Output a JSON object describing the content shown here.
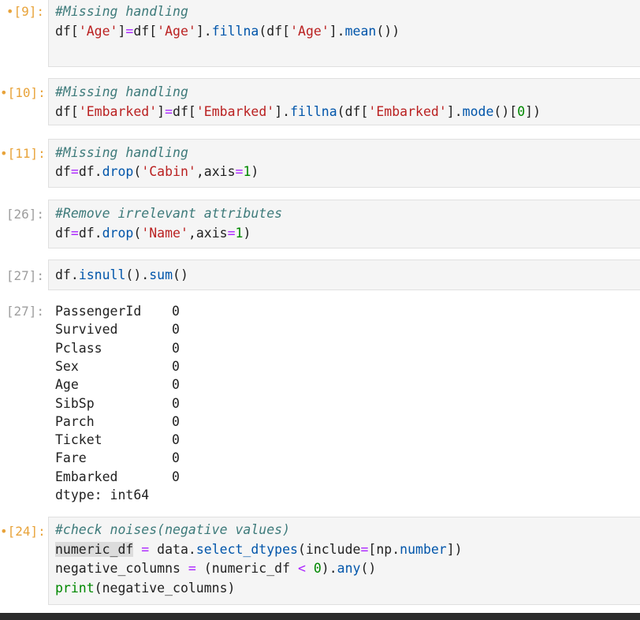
{
  "cells": [
    {
      "prompt": "[9]:",
      "dirty_marker": "•",
      "lines": [
        [
          {
            "t": "#Missing handling",
            "c": "cm"
          }
        ],
        [
          {
            "t": "df[",
            "c": ""
          },
          {
            "t": "'Age'",
            "c": "st"
          },
          {
            "t": "]",
            "c": ""
          },
          {
            "t": "=",
            "c": "op"
          },
          {
            "t": "df[",
            "c": ""
          },
          {
            "t": "'Age'",
            "c": "st"
          },
          {
            "t": "].",
            "c": ""
          },
          {
            "t": "fillna",
            "c": "fn"
          },
          {
            "t": "(df[",
            "c": ""
          },
          {
            "t": "'Age'",
            "c": "st"
          },
          {
            "t": "].",
            "c": ""
          },
          {
            "t": "mean",
            "c": "fn"
          },
          {
            "t": "())",
            "c": ""
          }
        ]
      ]
    },
    {
      "prompt": "[10]:",
      "dirty_marker": "•",
      "lines": [
        [
          {
            "t": "#Missing handling",
            "c": "cm"
          }
        ],
        [
          {
            "t": "df[",
            "c": ""
          },
          {
            "t": "'Embarked'",
            "c": "st"
          },
          {
            "t": "]",
            "c": ""
          },
          {
            "t": "=",
            "c": "op"
          },
          {
            "t": "df[",
            "c": ""
          },
          {
            "t": "'Embarked'",
            "c": "st"
          },
          {
            "t": "].",
            "c": ""
          },
          {
            "t": "fillna",
            "c": "fn"
          },
          {
            "t": "(df[",
            "c": ""
          },
          {
            "t": "'Embarked'",
            "c": "st"
          },
          {
            "t": "].",
            "c": ""
          },
          {
            "t": "mode",
            "c": "fn"
          },
          {
            "t": "()[",
            "c": ""
          },
          {
            "t": "0",
            "c": "nu"
          },
          {
            "t": "])",
            "c": ""
          }
        ]
      ]
    },
    {
      "prompt": "[11]:",
      "dirty_marker": "•",
      "lines": [
        [
          {
            "t": "#Missing handling",
            "c": "cm"
          }
        ],
        [
          {
            "t": "df",
            "c": ""
          },
          {
            "t": "=",
            "c": "op"
          },
          {
            "t": "df",
            "c": ""
          },
          {
            "t": ".",
            "c": ""
          },
          {
            "t": "drop",
            "c": "fn"
          },
          {
            "t": "(",
            "c": ""
          },
          {
            "t": "'Cabin'",
            "c": "st"
          },
          {
            "t": ",axis",
            "c": ""
          },
          {
            "t": "=",
            "c": "op"
          },
          {
            "t": "1",
            "c": "nu"
          },
          {
            "t": ")",
            "c": ""
          }
        ]
      ]
    },
    {
      "prompt": "[26]:",
      "dirty_marker": "",
      "lines": [
        [
          {
            "t": "#Remove irrelevant attributes",
            "c": "cm"
          }
        ],
        [
          {
            "t": "df",
            "c": ""
          },
          {
            "t": "=",
            "c": "op"
          },
          {
            "t": "df",
            "c": ""
          },
          {
            "t": ".",
            "c": ""
          },
          {
            "t": "drop",
            "c": "fn"
          },
          {
            "t": "(",
            "c": ""
          },
          {
            "t": "'Name'",
            "c": "st"
          },
          {
            "t": ",axis",
            "c": ""
          },
          {
            "t": "=",
            "c": "op"
          },
          {
            "t": "1",
            "c": "nu"
          },
          {
            "t": ")",
            "c": ""
          }
        ]
      ]
    },
    {
      "prompt": "[27]:",
      "dirty_marker": "",
      "lines": [
        [
          {
            "t": "df",
            "c": ""
          },
          {
            "t": ".",
            "c": ""
          },
          {
            "t": "isnull",
            "c": "fn"
          },
          {
            "t": "().",
            "c": ""
          },
          {
            "t": "sum",
            "c": "fn"
          },
          {
            "t": "()",
            "c": ""
          }
        ]
      ]
    },
    {
      "prompt": "[24]:",
      "dirty_marker": "•",
      "lines": [
        [
          {
            "t": "#check noises(negative values)",
            "c": "cm"
          }
        ],
        [
          {
            "t": "numeric_df",
            "c": "hl"
          },
          {
            "t": " ",
            "c": ""
          },
          {
            "t": "=",
            "c": "op"
          },
          {
            "t": " data",
            "c": ""
          },
          {
            "t": ".",
            "c": ""
          },
          {
            "t": "select_dtypes",
            "c": "fn"
          },
          {
            "t": "(include",
            "c": ""
          },
          {
            "t": "=",
            "c": "op"
          },
          {
            "t": "[np",
            "c": ""
          },
          {
            "t": ".",
            "c": ""
          },
          {
            "t": "number",
            "c": "fn"
          },
          {
            "t": "])",
            "c": ""
          }
        ],
        [
          {
            "t": "negative_columns ",
            "c": ""
          },
          {
            "t": "=",
            "c": "op"
          },
          {
            "t": " (numeric_df ",
            "c": ""
          },
          {
            "t": "<",
            "c": "op"
          },
          {
            "t": " ",
            "c": ""
          },
          {
            "t": "0",
            "c": "nu"
          },
          {
            "t": ").",
            "c": ""
          },
          {
            "t": "any",
            "c": "fn"
          },
          {
            "t": "()",
            "c": ""
          }
        ],
        [
          {
            "t": "print",
            "c": "nu"
          },
          {
            "t": "(negative_columns)",
            "c": ""
          }
        ]
      ]
    }
  ],
  "output": {
    "prompt": "[27]:",
    "rows": [
      {
        "name": "PassengerId",
        "value": "0"
      },
      {
        "name": "Survived",
        "value": "0"
      },
      {
        "name": "Pclass",
        "value": "0"
      },
      {
        "name": "Sex",
        "value": "0"
      },
      {
        "name": "Age",
        "value": "0"
      },
      {
        "name": "SibSp",
        "value": "0"
      },
      {
        "name": "Parch",
        "value": "0"
      },
      {
        "name": "Ticket",
        "value": "0"
      },
      {
        "name": "Fare",
        "value": "0"
      },
      {
        "name": "Embarked",
        "value": "0"
      }
    ],
    "dtype_line": "dtype: int64"
  }
}
